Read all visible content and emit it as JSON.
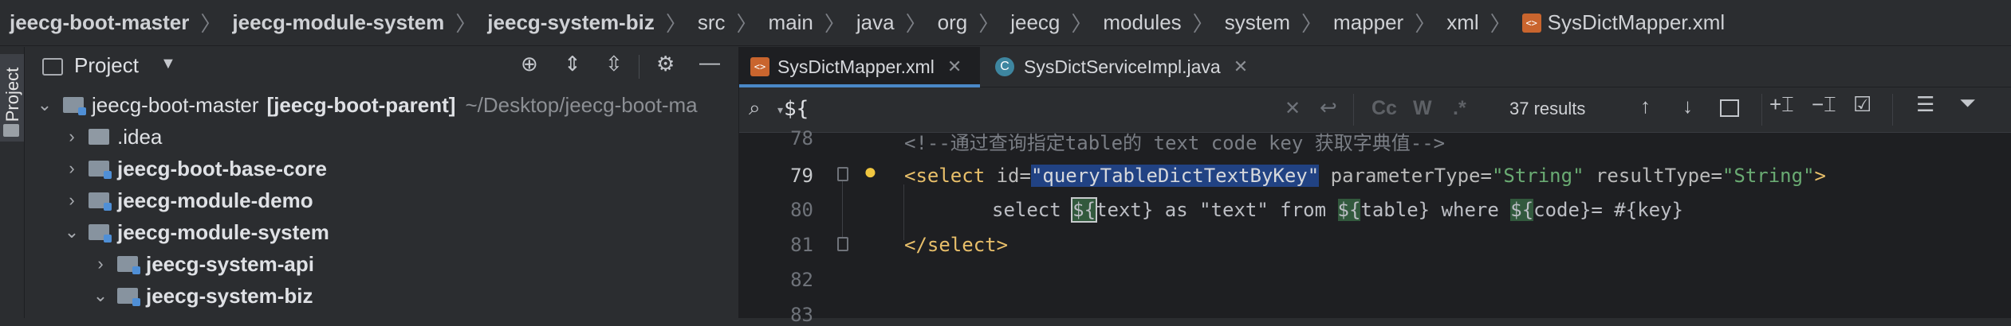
{
  "breadcrumb": {
    "items": [
      "jeecg-boot-master",
      "jeecg-module-system",
      "jeecg-system-biz",
      "src",
      "main",
      "java",
      "org",
      "jeecg",
      "modules",
      "system",
      "mapper",
      "xml",
      "SysDictMapper.xml"
    ],
    "separator": "〉",
    "file_icon": "xml-file-icon"
  },
  "strip": {
    "project_label": "Project"
  },
  "project_panel": {
    "title": "Project",
    "tree": [
      {
        "name": "jeecg-boot-master",
        "suffix": "[jeecg-boot-parent]",
        "path": "~/Desktop/jeecg-boot-ma",
        "expanded": true
      },
      {
        "name": ".idea",
        "expanded": false
      },
      {
        "name": "jeecg-boot-base-core",
        "expanded": false
      },
      {
        "name": "jeecg-module-demo",
        "expanded": false
      },
      {
        "name": "jeecg-module-system",
        "expanded": true
      },
      {
        "name": "jeecg-system-api",
        "expanded": false
      },
      {
        "name": "jeecg-system-biz",
        "expanded": true
      }
    ]
  },
  "tabs": [
    {
      "label": "SysDictMapper.xml",
      "icon": "xml-file-icon",
      "active": true
    },
    {
      "label": "SysDictServiceImpl.java",
      "icon": "class-icon",
      "icon_text": "C",
      "active": false
    }
  ],
  "find": {
    "query": "${",
    "results": "37 results",
    "case_label": "Cc",
    "words_label": "W",
    "regex_label": ".*"
  },
  "editor": {
    "line_numbers": [
      "78",
      "79",
      "80",
      "81",
      "82",
      "83"
    ],
    "line78_comment": "<!--通过查询指定table的 text code key 获取字典值-->",
    "line79": {
      "open": "<select ",
      "id_attr": "id=",
      "id_value": "\"queryTableDictTextByKey\"",
      "param_attr": " parameterType=",
      "param_value": "\"String\"",
      "result_attr": " resultType=",
      "result_value": "\"String\"",
      "close": ">"
    },
    "line80": {
      "p1": "select ",
      "m1": "${",
      "p2": "text} as \"text\" from ",
      "m2": "${",
      "p3": "table} where ",
      "m3": "${",
      "p4": "code}= #{key}"
    },
    "line81": "</select>"
  },
  "colors": {
    "accent": "#4a88c7",
    "background": "#1e1f22",
    "panel": "#2b2d30",
    "tag": "#e8bf6a",
    "string": "#6aab73",
    "selection": "#214283",
    "match": "#32593d"
  }
}
